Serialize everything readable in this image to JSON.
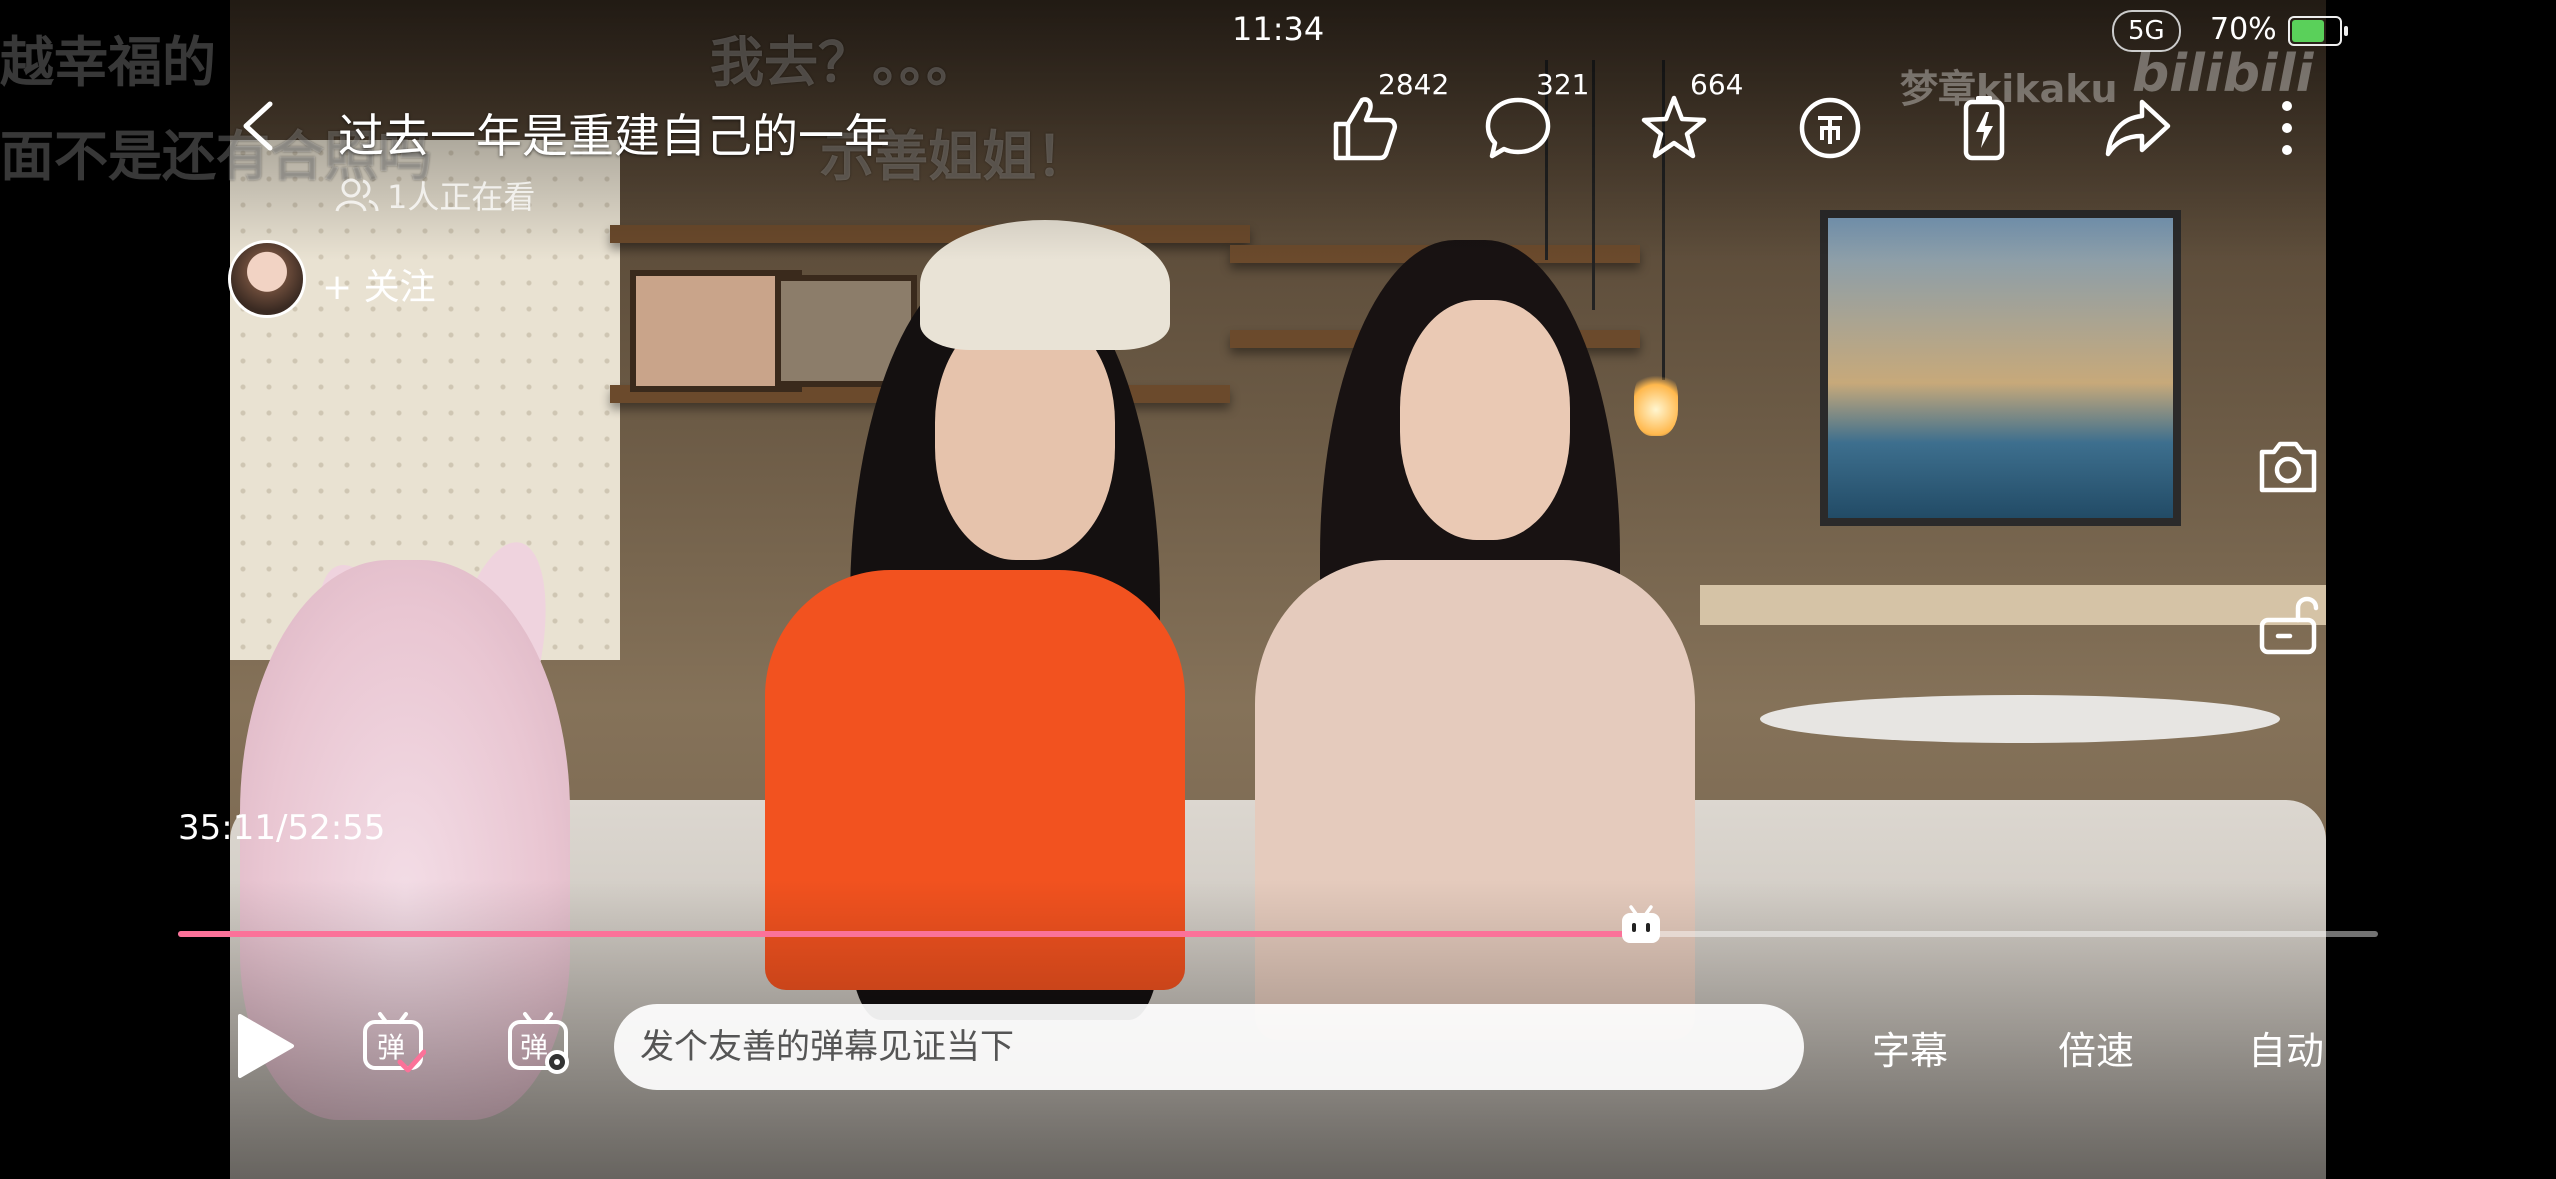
{
  "status_bar": {
    "time": "11:34",
    "network": "5G",
    "battery_text": "70%",
    "battery_level": 0.7,
    "battery_color": "#5ad05a"
  },
  "danmaku": [
    {
      "text": "越幸福的"
    },
    {
      "text": "我去？。。。"
    },
    {
      "text": "面不是还有合照吗"
    },
    {
      "text": "示善姐姐！"
    }
  ],
  "header": {
    "title": "过去一年是重建自己的一年",
    "watching": "1人正在看",
    "follow_label": "+ 关注",
    "watermark": "梦章kikaku",
    "watermark_logo": "bilibili"
  },
  "top_actions": {
    "like_count": "2842",
    "comment_count": "321",
    "favorite_count": "664"
  },
  "player": {
    "time_display": "35:11/52:55",
    "progress": 0.665,
    "accent_color": "#fb7299",
    "danmaku_placeholder": "发个友善的弹幕见证当下",
    "subtitle_label": "字幕",
    "speed_label": "倍速",
    "quality_label": "自动"
  },
  "icons": {
    "back": "back-arrow-icon",
    "like": "thumbs-up-icon",
    "comment": "comment-bubble-icon",
    "favorite": "star-icon",
    "coin": "coin-icon",
    "charge": "battery-charge-icon",
    "share": "share-icon",
    "more": "more-vertical-icon",
    "screenshot": "camera-icon",
    "lock": "unlock-icon",
    "play": "play-icon",
    "danmaku_toggle": "danmaku-on-icon",
    "danmaku_settings": "danmaku-settings-icon"
  }
}
